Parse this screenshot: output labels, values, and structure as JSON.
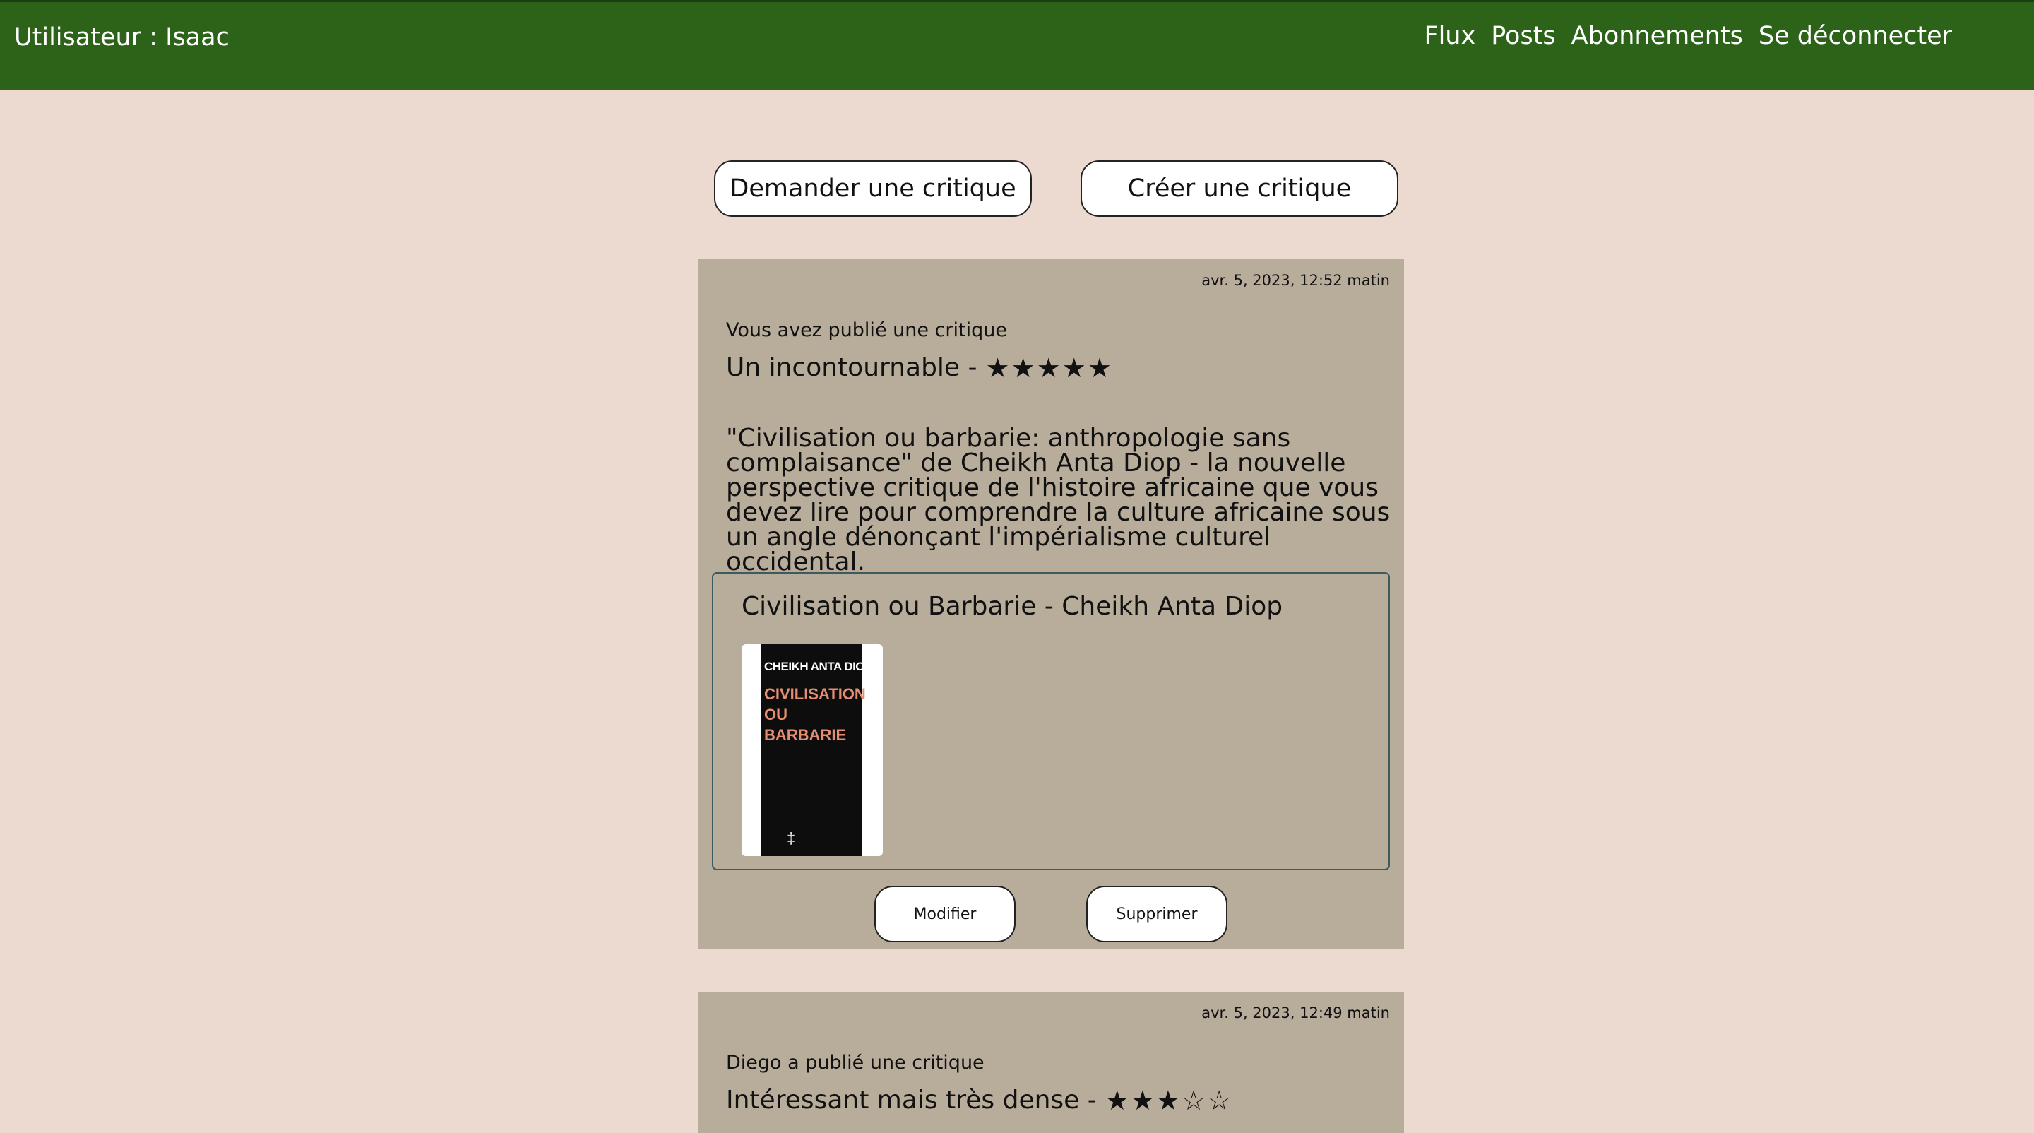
{
  "header": {
    "user_label": "Utilisateur : Isaac",
    "nav": [
      "Flux",
      "Posts",
      "Abonnements",
      "Se déconnecter"
    ]
  },
  "actions": {
    "ask_review": "Demander une critique",
    "create_review": "Créer une critique"
  },
  "posts": [
    {
      "date": "avr. 5, 2023, 12:52 matin",
      "author_line": "Vous avez publié une critique",
      "headline": "Un incontournable -",
      "rating": 5,
      "body": "\"Civilisation ou barbarie: anthropologie sans complaisance\" de Cheikh Anta Diop - la nouvelle perspective critique de l'histoire africaine que vous devez lire pour comprendre la culture africaine sous un angle dénonçant l'impérialisme culturel occidental.",
      "ticket": {
        "title": "Civilisation ou Barbarie - Cheikh Anta Diop",
        "cover": {
          "author": "CHEIKH ANTA DIOP",
          "title_lines": [
            "CIVILISATION",
            "OU",
            "BARBARIE"
          ]
        }
      },
      "edit_label": "Modifier",
      "delete_label": "Supprimer"
    },
    {
      "date": "avr. 5, 2023, 12:49 matin",
      "author_line": "Diego a publié une critique",
      "headline": "Intéressant mais très dense -",
      "rating": 3
    }
  ],
  "colors": {
    "header_bg": "#2c6319",
    "page_bg": "#ecd9d0",
    "card_bg": "#b8ac9b"
  }
}
